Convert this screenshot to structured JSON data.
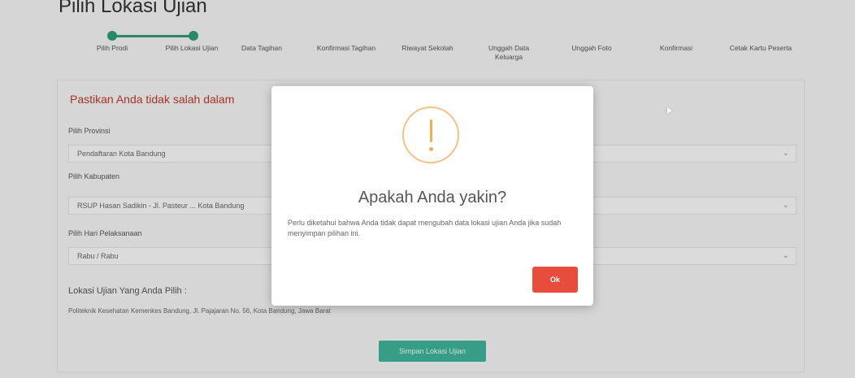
{
  "page": {
    "title": "Pilih Lokasi Ujian"
  },
  "stepper": {
    "steps": [
      "Pilih Prodi",
      "Pilih Lokasi Ujian",
      "Data Tagihan",
      "Konfirmasi Tagihan",
      "Riwayat Sekolah",
      "Unggah Data Keluarga",
      "Unggah Foto",
      "Konfirmasi",
      "Cetak Kartu Peserta"
    ],
    "completed": 2
  },
  "form": {
    "warning": "Pastikan Anda tidak salah dalam",
    "provinsi_label": "Pilih Provinsi",
    "provinsi_value": "Pendaftaran Kota Bandung",
    "kabupaten_label": "Pilih Kabupaten",
    "kabupaten_value": "RSUP Hasan Sadikin - Jl. Pasteur ... Kota Bandung",
    "jadwal_label": "Pilih Hari Pelaksanaan",
    "jadwal_value": "Rabu / Rabu",
    "lokasi_title": "Lokasi Ujian Yang Anda Pilih :",
    "lokasi_text": "Politeknik Kesehatan Kemenkes Bandung, Jl. Pajajaran No. 56, Kota Bandung, Jawa Barat",
    "submit_label": "Simpan Lokasi Ujian"
  },
  "modal": {
    "title": "Apakah Anda yakin?",
    "text": "Perlu diketahui bahwa Anda tidak dapat mengubah data lokasi ujian Anda jika sudah menyimpan pilihan ini.",
    "ok_label": "Ok"
  },
  "colors": {
    "accent": "#2e9c72",
    "danger": "#e74c3c",
    "warning": "#f0ad4e",
    "submit": "#3fb39a"
  }
}
